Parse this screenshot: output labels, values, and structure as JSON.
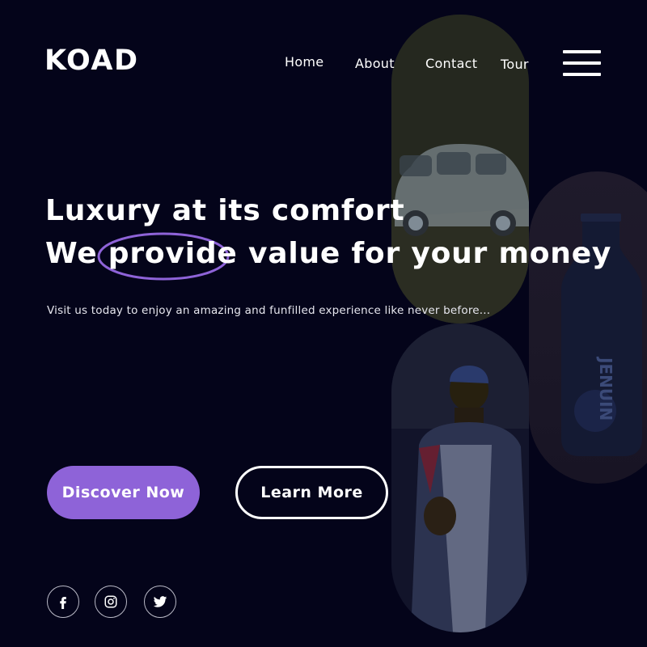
{
  "brand": {
    "logo_text": "KOAD"
  },
  "nav": {
    "items": [
      {
        "label": "Home"
      },
      {
        "label": "About"
      },
      {
        "label": "Contact"
      },
      {
        "label": "Tour"
      }
    ],
    "menu_icon": "hamburger-icon"
  },
  "hero": {
    "line1_strong": "Luxury",
    "line1_rest": " at its comfort",
    "line2_prefix": "We ",
    "line2_highlight": "provide",
    "line2_rest": " value for your money",
    "subtitle": "Visit us today to enjoy an amazing and funfilled experience like never before..."
  },
  "buttons": {
    "primary_label": "Discover Now",
    "secondary_label": "Learn More"
  },
  "social": [
    {
      "icon": "facebook-icon"
    },
    {
      "icon": "instagram-icon"
    },
    {
      "icon": "twitter-icon"
    }
  ],
  "gallery": {
    "bottle_label": "JENUIN",
    "images": [
      "car-image",
      "bottle-image",
      "person-image"
    ]
  },
  "colors": {
    "background": "#04041a",
    "accent": "#8e63d8",
    "text": "#ffffff"
  }
}
